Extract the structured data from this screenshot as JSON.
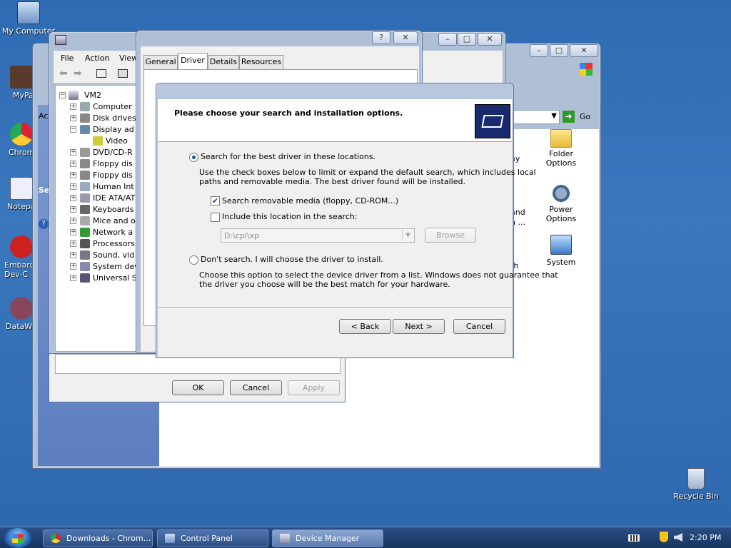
{
  "desktop": {
    "icons": [
      {
        "label": "My Computer"
      },
      {
        "label": "MyPa"
      },
      {
        "label": "Chrom"
      },
      {
        "label": "Notepa"
      },
      {
        "label": "Embarc Dev-C"
      },
      {
        "label": "DataWa"
      },
      {
        "label": "Recycle Bin"
      }
    ]
  },
  "device_manager": {
    "menu": [
      "File",
      "Action",
      "View"
    ],
    "tree": {
      "root": "VM2",
      "items": [
        {
          "label": "Computer",
          "expanded": false
        },
        {
          "label": "Disk drives",
          "expanded": false
        },
        {
          "label": "Display ad",
          "expanded": true
        },
        {
          "label": "Video",
          "child": true
        },
        {
          "label": "DVD/CD-R",
          "expanded": false
        },
        {
          "label": "Floppy dis",
          "expanded": false
        },
        {
          "label": "Floppy dis",
          "expanded": false
        },
        {
          "label": "Human Int",
          "expanded": false
        },
        {
          "label": "IDE ATA/AT",
          "expanded": false
        },
        {
          "label": "Keyboards",
          "expanded": false
        },
        {
          "label": "Mice and o",
          "expanded": false
        },
        {
          "label": "Network a",
          "expanded": false
        },
        {
          "label": "Processors",
          "expanded": false
        },
        {
          "label": "Sound, vid",
          "expanded": false
        },
        {
          "label": "System dev",
          "expanded": false
        },
        {
          "label": "Universal S",
          "expanded": false
        }
      ]
    }
  },
  "properties": {
    "tabs": [
      "General",
      "Driver",
      "Details",
      "Resources"
    ],
    "active_tab": "Driver",
    "buttons": {
      "ok": "OK",
      "cancel": "Cancel",
      "apply": "Apply"
    },
    "help_btn": "?",
    "close_btn": "✕"
  },
  "control_panel": {
    "go_label": "Go",
    "side_labels": {
      "ac": "Ac",
      "se": "Se"
    },
    "partial_labels": {
      "ay": "ay",
      "and": "and",
      "n": "n ...",
      "th": "th"
    },
    "items": [
      {
        "label": "Folder Options"
      },
      {
        "label": "Power Options"
      },
      {
        "label": "System"
      }
    ]
  },
  "wizard": {
    "header": "Please choose your search and installation options.",
    "option1_label": "Search for the best driver in these locations.",
    "option1_desc_line1": "Use the check boxes below to limit or expand the default search, which includes local",
    "option1_desc_line2": "paths and removable media. The best driver found will be installed.",
    "check1_label": "Search removable media (floppy, CD-ROM...)",
    "check1_checked": true,
    "check2_label": "Include this location in the search:",
    "check2_checked": false,
    "path_value": "D:\\cpl\\xp",
    "browse_label": "Browse",
    "option2_label": "Don't search. I will choose the driver to install.",
    "option2_desc_line1": "Choose this option to select the device driver from a list.  Windows does not guarantee that",
    "option2_desc_line2": "the driver you choose will be the best match for your hardware.",
    "back_label": "< Back",
    "next_label": "Next >",
    "cancel_label": "Cancel",
    "selected_option": 1
  },
  "taskbar": {
    "buttons": [
      {
        "label": "Downloads - Chrom..."
      },
      {
        "label": "Control Panel"
      },
      {
        "label": "Device Manager"
      }
    ],
    "clock": "2:20 PM"
  },
  "colors": {
    "desktop": "#2f6bb3",
    "window_frame": "#aebfd6",
    "taskbar": "#1f3f70",
    "wizard_header_icon": "#1a2a6e"
  }
}
